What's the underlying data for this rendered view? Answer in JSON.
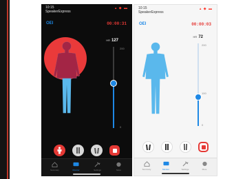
{
  "colors": {
    "accent": "#1e88e5",
    "body_blue": "#5ab8ec",
    "alert_red": "#e53935",
    "heat_red": "#ea3a3a",
    "body_dark_red": "#a32545"
  },
  "dark_screen": {
    "status_time": "10:15",
    "carrier": "SpeakerExpress",
    "mode_label": "OEI",
    "timer": "00:00:31",
    "reading_unit": "HR",
    "reading_value": "127",
    "scale_max": "200",
    "scale_min": "0",
    "level_fraction": 0.55,
    "tabs": [
      "Summary",
      "Monitor",
      "Settings",
      "More"
    ],
    "active_tab": 1
  },
  "light_screen": {
    "status_time": "10:15",
    "carrier": "SpeakerExpress",
    "mode_label": "OEI",
    "timer": "00:00:03",
    "reading_unit": "HR",
    "reading_value": "72",
    "scale_max": "200",
    "scale_mid": "100",
    "scale_min": "0",
    "level_fraction": 0.35,
    "tabs": [
      "Summary",
      "Monitor",
      "Settings",
      "More"
    ],
    "active_tab": 1
  },
  "icons": {
    "body_front": "person-front-icon",
    "body_side": "person-side-icon",
    "body_back": "person-back-icon",
    "stop": "stop-icon",
    "home": "home-icon",
    "monitor": "monitor-icon",
    "tools": "tools-icon",
    "more": "more-icon"
  }
}
